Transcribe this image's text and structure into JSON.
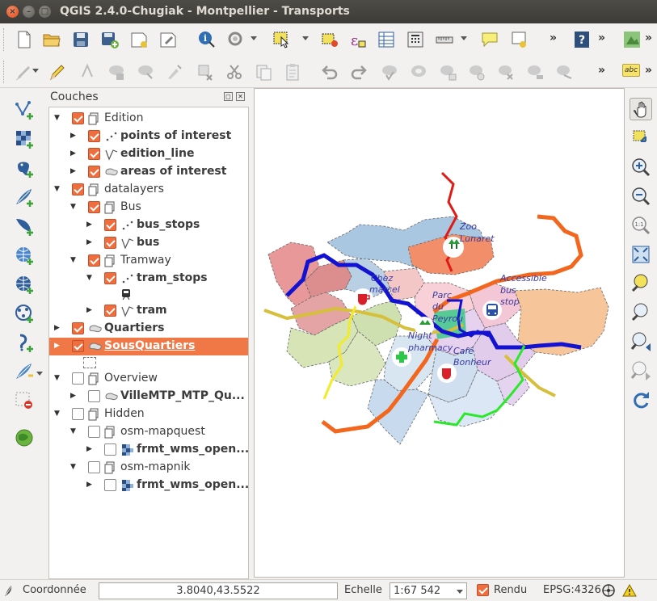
{
  "window": {
    "title": "QGIS 2.4.0-Chugiak - Montpellier - Transports"
  },
  "toolbar_top": {
    "icons": [
      "new-project-icon",
      "open-project-icon",
      "save-project-icon",
      "save-as-icon",
      "new-print-composer-icon",
      "composer-manager-icon",
      "identify-icon",
      "measure-icon",
      "select-features-icon",
      "deselect-icon",
      "expression-select-icon",
      "attribute-table-icon",
      "field-calculator-icon",
      "measure-line-icon",
      "map-tips-icon",
      "text-annotation-icon",
      "help-icon",
      "plugins-icon"
    ],
    "overflow": "»"
  },
  "toolbar_edit": {
    "icons": [
      "current-edits-icon",
      "toggle-editing-icon",
      "add-feature-icon",
      "move-feature-icon",
      "node-tool-icon",
      "delete-selected-icon",
      "cut-features-icon",
      "copy-features-icon",
      "paste-features-icon",
      "undo-icon",
      "redo-icon",
      "simplify-icon",
      "add-ring-icon",
      "add-part-icon",
      "fill-ring-icon",
      "delete-ring-icon",
      "delete-part-icon",
      "reshape-icon",
      "label-icon"
    ],
    "overflow": "»",
    "label_badge": "abc"
  },
  "left_tools": {
    "icons": [
      "add-vector-layer-icon",
      "add-raster-layer-icon",
      "add-postgis-layer-icon",
      "add-spatialite-layer-icon",
      "add-mssql-layer-icon",
      "add-wms-layer-icon",
      "add-wcs-layer-icon",
      "add-wfs-layer-icon",
      "add-delimited-text-icon",
      "new-shapefile-icon",
      "remove-layer-icon",
      "openlayers-icon"
    ]
  },
  "layers_panel": {
    "title": "Couches",
    "float_btn": "◻",
    "close_btn": "✕",
    "rows": [
      {
        "label": "Edition",
        "kind": "group",
        "checked": true,
        "expanded": true,
        "bold": false
      },
      {
        "label": "points of interest",
        "kind": "point",
        "checked": true,
        "expanded": false,
        "bold": true
      },
      {
        "label": "edition_line",
        "kind": "line",
        "checked": true,
        "expanded": false,
        "bold": true
      },
      {
        "label": "areas of interest",
        "kind": "polygon",
        "checked": true,
        "expanded": false,
        "bold": true
      },
      {
        "label": "datalayers",
        "kind": "group",
        "checked": true,
        "expanded": true,
        "bold": false
      },
      {
        "label": "Bus",
        "kind": "group",
        "checked": true,
        "expanded": true,
        "bold": false
      },
      {
        "label": "bus_stops",
        "kind": "point",
        "checked": true,
        "expanded": false,
        "bold": true
      },
      {
        "label": "bus",
        "kind": "line",
        "checked": true,
        "expanded": false,
        "bold": true
      },
      {
        "label": "Tramway",
        "kind": "group",
        "checked": true,
        "expanded": true,
        "bold": false
      },
      {
        "label": "tram_stops",
        "kind": "point",
        "checked": true,
        "expanded": true,
        "bold": true
      },
      {
        "label": "tram",
        "kind": "line",
        "checked": true,
        "expanded": false,
        "bold": true
      },
      {
        "label": "Quartiers",
        "kind": "polygon",
        "checked": true,
        "expanded": false,
        "bold": true
      },
      {
        "label": "SousQuartiers",
        "kind": "polygon",
        "checked": true,
        "expanded": false,
        "bold": true,
        "selected": true
      },
      {
        "label": "Overview",
        "kind": "group",
        "checked": false,
        "expanded": true,
        "bold": false
      },
      {
        "label": "VilleMTP_MTP_Qu...",
        "kind": "polygon",
        "checked": false,
        "expanded": false,
        "bold": true
      },
      {
        "label": "Hidden",
        "kind": "group",
        "checked": false,
        "expanded": true,
        "bold": false
      },
      {
        "label": "osm-mapquest",
        "kind": "group",
        "checked": false,
        "expanded": true,
        "bold": false
      },
      {
        "label": "frmt_wms_open...",
        "kind": "raster",
        "checked": false,
        "expanded": false,
        "bold": true
      },
      {
        "label": "osm-mapnik",
        "kind": "group",
        "checked": false,
        "expanded": true,
        "bold": false
      },
      {
        "label": "frmt_wms_open...",
        "kind": "raster",
        "checked": false,
        "expanded": false,
        "bold": true
      }
    ]
  },
  "map": {
    "labels": {
      "zoo": "Zoo",
      "lunaret": "Lunaret",
      "chez": "Chez",
      "marcel": "marcel",
      "parc": "Parc",
      "du": "du",
      "peyrou": "Peyrou",
      "accessible": "Accessible",
      "bus": "bus",
      "stop": "stop",
      "night": "Night",
      "pharmacy": "pharmacy",
      "cafe": "Café",
      "bonheur": "Bonheur"
    }
  },
  "right_tools": {
    "icons": [
      "pan-icon",
      "pan-to-selection-icon",
      "zoom-in-icon",
      "zoom-out-icon",
      "zoom-actual-icon",
      "zoom-full-icon",
      "zoom-to-selection-icon",
      "zoom-to-layer-icon",
      "zoom-last-icon",
      "zoom-next-icon",
      "refresh-icon"
    ]
  },
  "status": {
    "coord_label": "Coordonnée",
    "coord_value": "3.8040,43.5522",
    "scale_label": "Echelle",
    "scale_value": "1:67 542",
    "render_label": "Rendu",
    "render_checked": true,
    "crs": "EPSG:4326"
  }
}
